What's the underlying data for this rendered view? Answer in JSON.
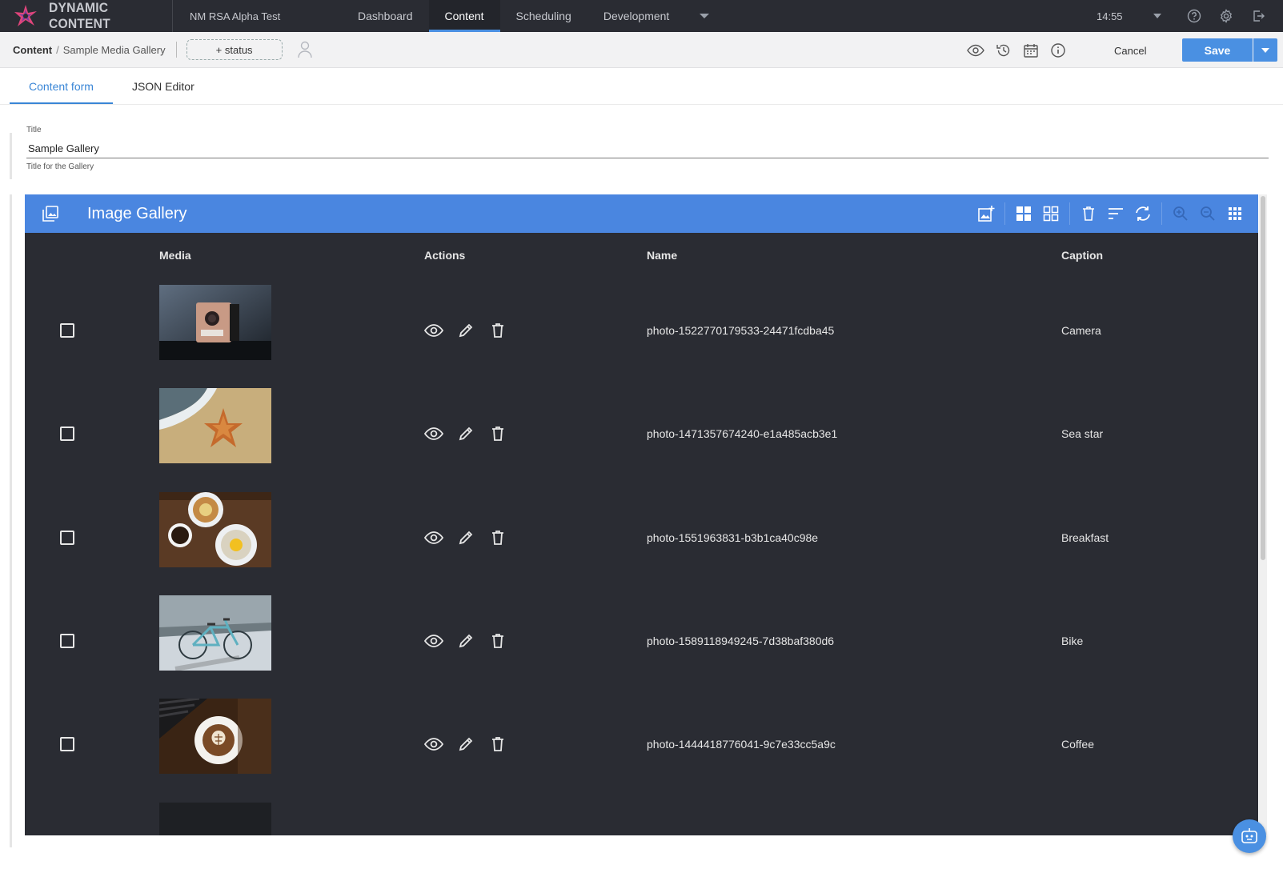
{
  "topbar": {
    "brand": "DYNAMIC CONTENT",
    "hub": "NM RSA Alpha Test",
    "nav": [
      "Dashboard",
      "Content",
      "Scheduling"
    ],
    "active_nav": "Content",
    "dropdown": "Development",
    "time": "14:55",
    "icons": [
      "help-icon",
      "gear-icon",
      "logout-icon"
    ]
  },
  "subbar": {
    "breadcrumb_root": "Content",
    "breadcrumb_sep": "/",
    "breadcrumb_item": "Sample Media Gallery",
    "status_label": "+ status",
    "icons": [
      "eye-icon",
      "history-icon",
      "calendar-icon",
      "info-icon"
    ],
    "cancel_label": "Cancel",
    "save_label": "Save"
  },
  "form_tabs": [
    "Content form",
    "JSON Editor"
  ],
  "active_form_tab": "Content form",
  "title_field": {
    "label": "Title",
    "value": "Sample Gallery",
    "help": "Title for the Gallery"
  },
  "gallery": {
    "title": "Image Gallery",
    "columns": [
      "Media",
      "Actions",
      "Name",
      "Caption"
    ],
    "tools": [
      "add-image-icon",
      "large-grid-icon",
      "small-grid-icon",
      "delete-icon",
      "sort-icon",
      "sync-icon",
      "zoom-in-icon",
      "zoom-out-icon",
      "apps-grid-icon"
    ],
    "rows": [
      {
        "name": "photo-1522770179533-24471fcdba45",
        "caption": "Camera",
        "thumb": "camera"
      },
      {
        "name": "photo-1471357674240-e1a485acb3e1",
        "caption": "Sea star",
        "thumb": "seastar"
      },
      {
        "name": "photo-1551963831-b3b1ca40c98e",
        "caption": "Breakfast",
        "thumb": "breakfast"
      },
      {
        "name": "photo-1589118949245-7d38baf380d6",
        "caption": "Bike",
        "thumb": "bike"
      },
      {
        "name": "photo-1444418776041-9c7e33cc5a9c",
        "caption": "Coffee",
        "thumb": "coffee"
      }
    ]
  },
  "colors": {
    "topbar": "#2a2c33",
    "accent": "#4a90e2",
    "gallery_header": "#4a86e0",
    "gallery_body": "#2a2c33"
  }
}
